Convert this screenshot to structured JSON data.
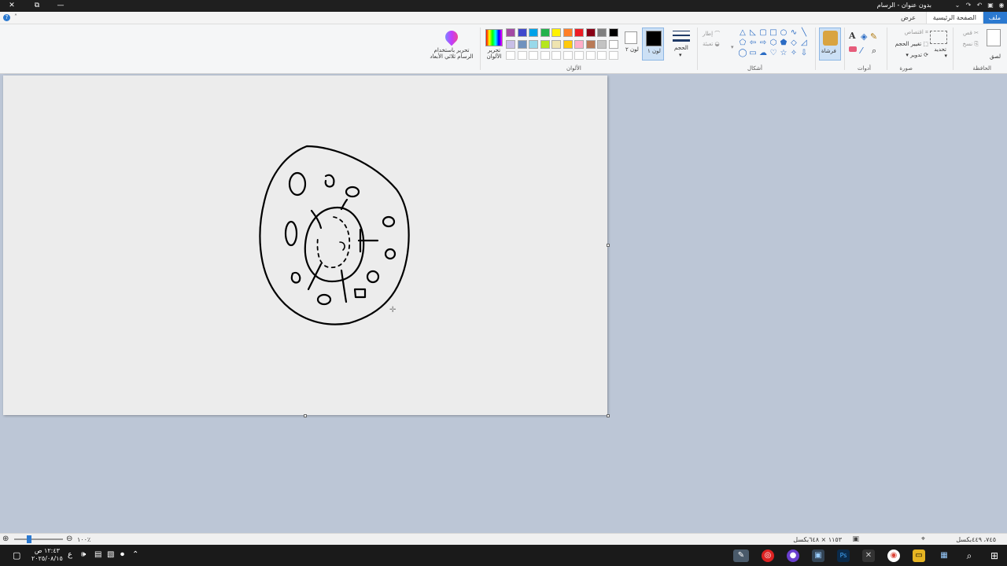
{
  "window": {
    "title": "بدون عنوان - الرسام",
    "minimize_glyph": "—",
    "restore_glyph": "⧉",
    "close_glyph": "✕"
  },
  "tabs": {
    "file": "ملف",
    "home": "الصفحة الرئيسية",
    "view": "عرض"
  },
  "ribbon": {
    "clipboard": {
      "paste": "لصق",
      "cut": "قص",
      "copy": "نسخ",
      "label": "الحافظة"
    },
    "image": {
      "select": "تحديد",
      "crop": "اقتصاص",
      "resize": "تغيير الحجم",
      "rotate": "تدوير",
      "label": "صورة"
    },
    "tools": {
      "label": "أدوات"
    },
    "brushes": {
      "label": "فرشاة"
    },
    "shapes": {
      "outline": "إطار",
      "fill": "تعبئة",
      "label": "أشكال"
    },
    "size": {
      "label": "الحجم"
    },
    "color1": {
      "label": "لون ١"
    },
    "color2": {
      "label": "لون ٢"
    },
    "colors": {
      "label": "الألوان",
      "edit": "تحرير الألوان",
      "row1": [
        "#000000",
        "#7f7f7f",
        "#880015",
        "#ed1c24",
        "#ff7f27",
        "#fff200",
        "#22b14c",
        "#00a2e8",
        "#3f48cc",
        "#a349a4"
      ],
      "row2": [
        "#ffffff",
        "#c3c3c3",
        "#b97a57",
        "#ffaec9",
        "#ffc90e",
        "#efe4b0",
        "#b5e61d",
        "#99d9ea",
        "#7092be",
        "#c8bfe7"
      ]
    },
    "paint3d": {
      "label": "تحرير باستخدام الرسام ثلاثي الأبعاد"
    }
  },
  "status": {
    "cursor_pos": "٧٤٥، ٤٤٩بكسل",
    "canvas_size": "١١٥٣ × ٦٤٨بكسل",
    "zoom": "١٠٠٪",
    "zoom_level": 0.3
  },
  "taskbar": {
    "time": "١٢:٤٣ ص",
    "date": "٢٠٢٥/٠٨/١٥",
    "lang": "ع"
  }
}
